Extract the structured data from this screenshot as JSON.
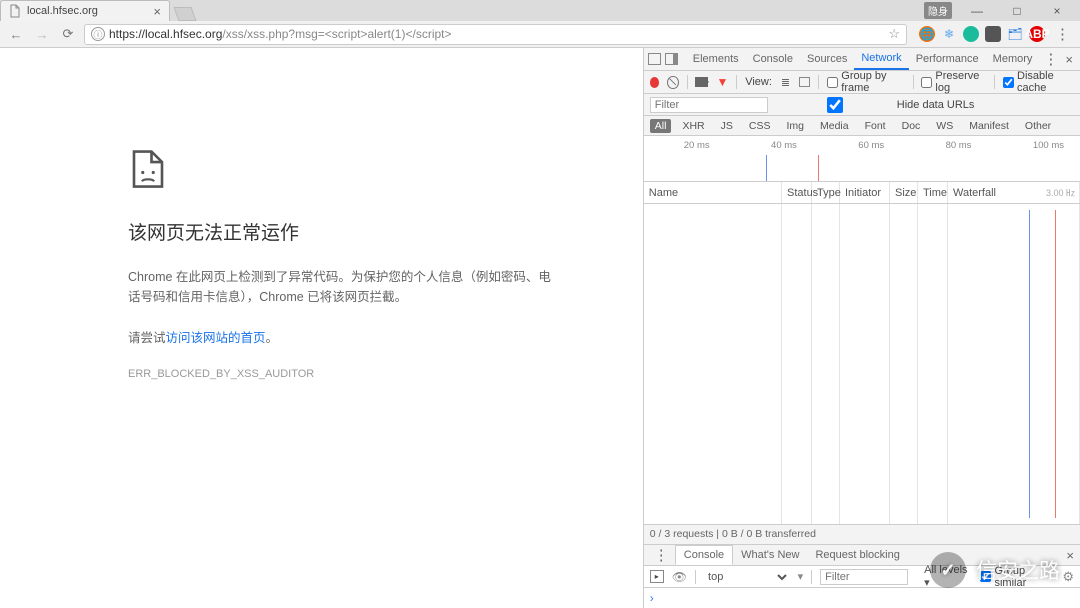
{
  "tab": {
    "title": "local.hfsec.org",
    "close": "×"
  },
  "window": {
    "incognito_label": "隐身",
    "min": "—",
    "max": "□",
    "close": "×"
  },
  "nav": {
    "back": "←",
    "forward": "→",
    "reload": "⟳"
  },
  "url": {
    "scheme": "https://",
    "host": "local.hfsec.org",
    "path": "/xss/xss.php?msg=<script>alert(1)</script>",
    "info_glyph": "ⓘ",
    "star": "☆"
  },
  "error": {
    "title": "该网页无法正常运作",
    "msg": "Chrome 在此网页上检测到了异常代码。为保护您的个人信息（例如密码、电话号码和信用卡信息），Chrome 已将该网页拦截。",
    "try_prefix": "请尝试",
    "try_link": "访问该网站的首页",
    "try_suffix": "。",
    "code": "ERR_BLOCKED_BY_XSS_AUDITOR"
  },
  "devtools": {
    "tabs": [
      "Elements",
      "Console",
      "Sources",
      "Network",
      "Performance",
      "Memory"
    ],
    "active_tab": "Network",
    "more": "⋮",
    "close": "×"
  },
  "net_toolbar": {
    "view_label": "View:",
    "group": "Group by frame",
    "preserve": "Preserve log",
    "disable": "Disable cache",
    "filter_placeholder": "Filter",
    "hide_urls": "Hide data URLs"
  },
  "net_types": [
    "All",
    "XHR",
    "JS",
    "CSS",
    "Img",
    "Media",
    "Font",
    "Doc",
    "WS",
    "Manifest",
    "Other"
  ],
  "net_types_active": "All",
  "timeline_ticks": [
    "20 ms",
    "40 ms",
    "60 ms",
    "80 ms",
    "100 ms"
  ],
  "net_cols": [
    "Name",
    "Status",
    "Type",
    "Initiator",
    "Size",
    "Time",
    "Waterfall"
  ],
  "net_hz": "3.00 ㎐",
  "net_status": "0 / 3 requests  |  0 B / 0 B transferred",
  "drawer": {
    "tabs": [
      "Console",
      "What's New",
      "Request blocking"
    ],
    "active": "Console",
    "close": "×",
    "more": "⋮",
    "top": "top",
    "filter_placeholder": "Filter",
    "levels": "All levels ▾",
    "group_similar": "Group similar",
    "prompt": "›"
  },
  "watermark": "信安之路"
}
